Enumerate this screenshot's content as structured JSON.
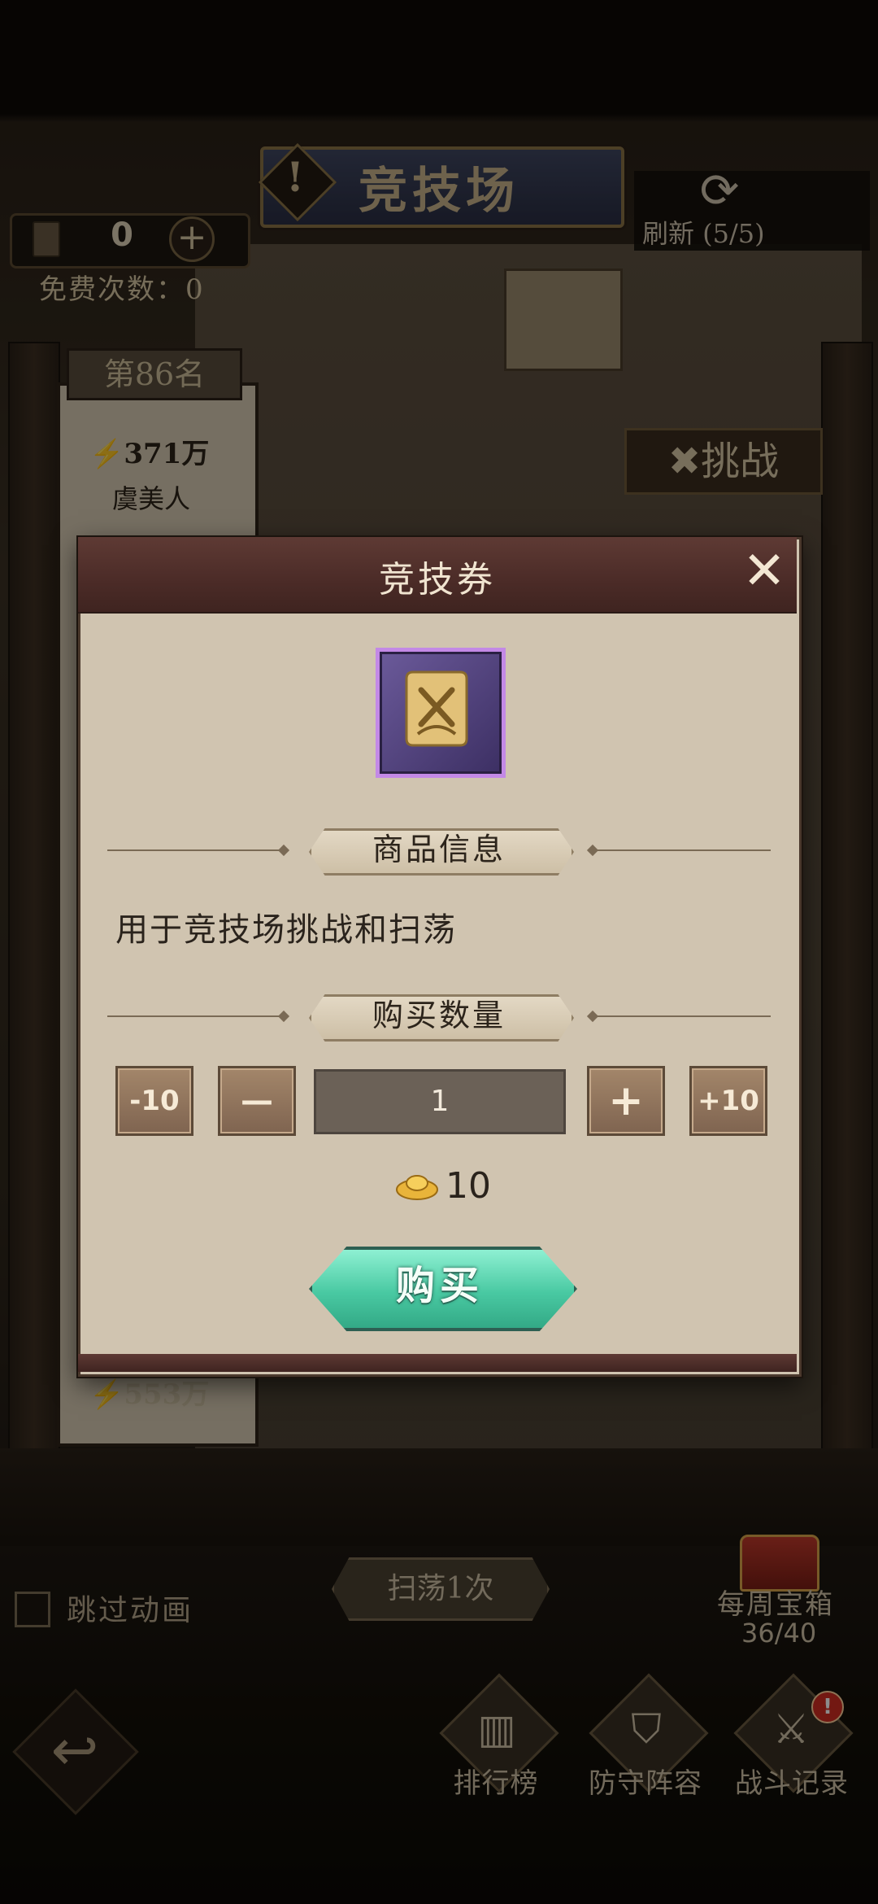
{
  "header": {
    "title": "竞技场",
    "alert_glyph": "!",
    "ticket_count": "0",
    "ticket_plus": "+",
    "free_count_label": "免费次数：0",
    "refresh_icon": "⟳",
    "refresh_label": "刷新 (5/5)"
  },
  "opponents": {
    "rank_label": "第86名",
    "first_power": "371万",
    "first_name": "虞美人",
    "challenge_label": "挑战",
    "second_power": "553万"
  },
  "modal": {
    "title": "竞技券",
    "close_glyph": "✕",
    "item_icon": "arena-ticket-scroll-icon",
    "item_frame_color": "#c389e6",
    "info_section_label": "商品信息",
    "description": "用于竞技场挑战和扫荡",
    "quantity_section_label": "购买数量",
    "buttons": {
      "minus10": "-10",
      "minus": "—",
      "plus": "+",
      "plus10": "+10"
    },
    "quantity_value": "1",
    "price_icon": "gold-ingot-icon",
    "price_value": "10",
    "buy_label": "购买",
    "buy_color": "#49c9a2"
  },
  "footer": {
    "skip_animation_label": "跳过动画",
    "skip_checked": false,
    "sweep_label": "扫荡1次",
    "chest_label": "每周宝箱",
    "chest_progress": "36/40",
    "back_glyph": "↩",
    "nav": [
      {
        "label": "排行榜",
        "icon": "leaderboard-icon",
        "glyph": "▥"
      },
      {
        "label": "防守阵容",
        "icon": "defense-lineup-icon",
        "glyph": "⛉"
      },
      {
        "label": "战斗记录",
        "icon": "battle-record-icon",
        "glyph": "⚔"
      }
    ],
    "nav_badge": "!"
  }
}
